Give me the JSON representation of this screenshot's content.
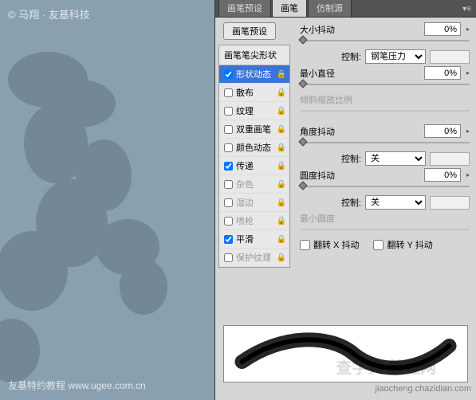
{
  "watermark": {
    "top": "© 马翔 · 友基科技",
    "bottom": "友基特约教程  www.ugee.com.cn",
    "right": "jiaocheng.chazidian.com",
    "center": "查字典 教程网"
  },
  "tabs": {
    "preset": "画笔预设",
    "brush": "画笔",
    "clone": "仿制源"
  },
  "presetBtn": "画笔预设",
  "optsHeader": "画笔笔尖形状",
  "opts": {
    "shape": "形状动态",
    "scatter": "散布",
    "texture": "纹理",
    "dual": "双重画笔",
    "color": "颜色动态",
    "transfer": "传递",
    "noise": "杂色",
    "wet": "湿边",
    "airbrush": "喷枪",
    "smooth": "平滑",
    "protect": "保护纹理"
  },
  "right": {
    "sizeJitter": "大小抖动",
    "sizeVal": "0%",
    "control": "控制:",
    "penPressure": "钢笔压力",
    "off": "关",
    "minDiameter": "最小直径",
    "minDiameterVal": "0%",
    "tiltScale": "倾斜缩放比例",
    "angleJitter": "角度抖动",
    "angleVal": "0%",
    "roundJitter": "圆度抖动",
    "roundVal": "0%",
    "minRound": "最小圆度",
    "flipX": "翻转 X 抖动",
    "flipY": "翻转 Y 抖动"
  }
}
